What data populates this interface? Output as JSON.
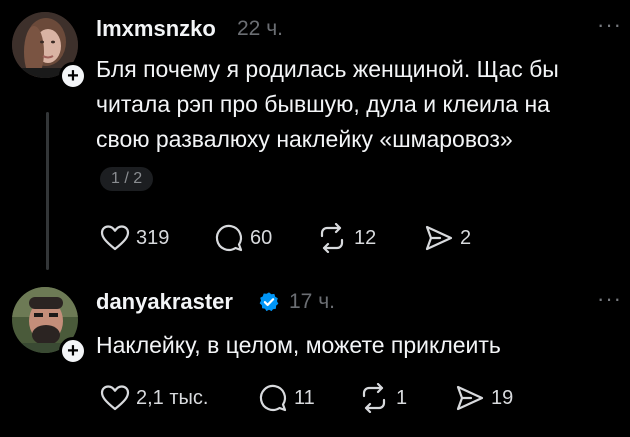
{
  "posts": [
    {
      "author": "lmxmsnzko",
      "time": "22 ч.",
      "lines": [
        "Бля почему я родилась женщиной. Щас бы",
        "читала рэп про бывшую, дула и клеила на",
        "свою развалюху наклейку «шмаровоз»"
      ],
      "page_indicator": "1 / 2",
      "likes": "319",
      "comments": "60",
      "reposts": "12",
      "shares": "2",
      "more": "···",
      "follow": "+"
    },
    {
      "author": "danyakraster",
      "verified": true,
      "time": "17 ч.",
      "lines": [
        "Наклейку, в целом, можете приклеить"
      ],
      "likes": "2,1 тыс.",
      "comments": "11",
      "reposts": "1",
      "shares": "19",
      "more": "···",
      "follow": "+"
    }
  ],
  "colors": {
    "background": "#000000",
    "text": "#f3f5f7",
    "muted": "#6b6e73",
    "verified": "#0095f6"
  },
  "icons": [
    "heart-icon",
    "comment-icon",
    "repost-icon",
    "share-icon",
    "verified-icon",
    "more-icon",
    "plus-icon"
  ]
}
